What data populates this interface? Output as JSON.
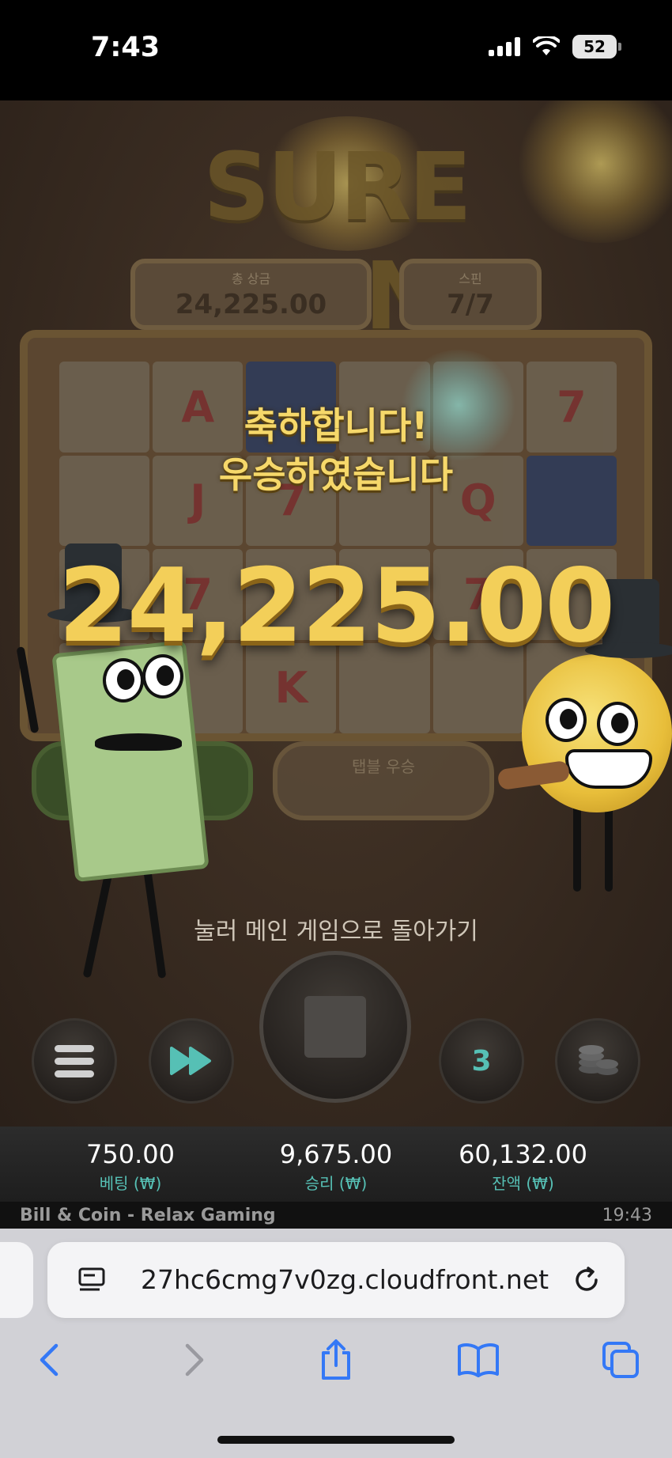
{
  "status_bar": {
    "time": "7:43",
    "battery": "52"
  },
  "game": {
    "logo": "SURE WIN",
    "total_win_label": "총 상금",
    "total_win_value": "24,225.00",
    "spin_label": "스핀",
    "spin_value": "7/7",
    "congrats_line1": "축하합니다!",
    "congrats_line2": "우승하였습니다",
    "win_amount": "24,225.00",
    "lower_box_label": "탭블 우승",
    "return_hint": "눌러 메인 게임으로 돌아가기",
    "reel_symbols": [
      "",
      "A",
      "",
      "",
      "",
      "7",
      "",
      "J",
      "7",
      "",
      "Q",
      "",
      "",
      "7",
      "",
      "",
      "7",
      "",
      "",
      "",
      "K",
      "",
      "",
      ""
    ]
  },
  "controls": {
    "autoplay_count": "3"
  },
  "balance": {
    "bet_value": "750.00",
    "bet_label": "베팅 (₩)",
    "win_value": "9,675.00",
    "win_label": "승리 (₩)",
    "balance_value": "60,132.00",
    "balance_label": "잔액 (₩)"
  },
  "footer": {
    "title": "Bill & Coin - Relax Gaming",
    "time": "19:43"
  },
  "browser": {
    "url": "27hc6cmg7v0zg.cloudfront.net"
  },
  "colors": {
    "accent_teal": "#56c0b5",
    "gold": "#f3cf59",
    "ios_blue": "#3478f6"
  }
}
